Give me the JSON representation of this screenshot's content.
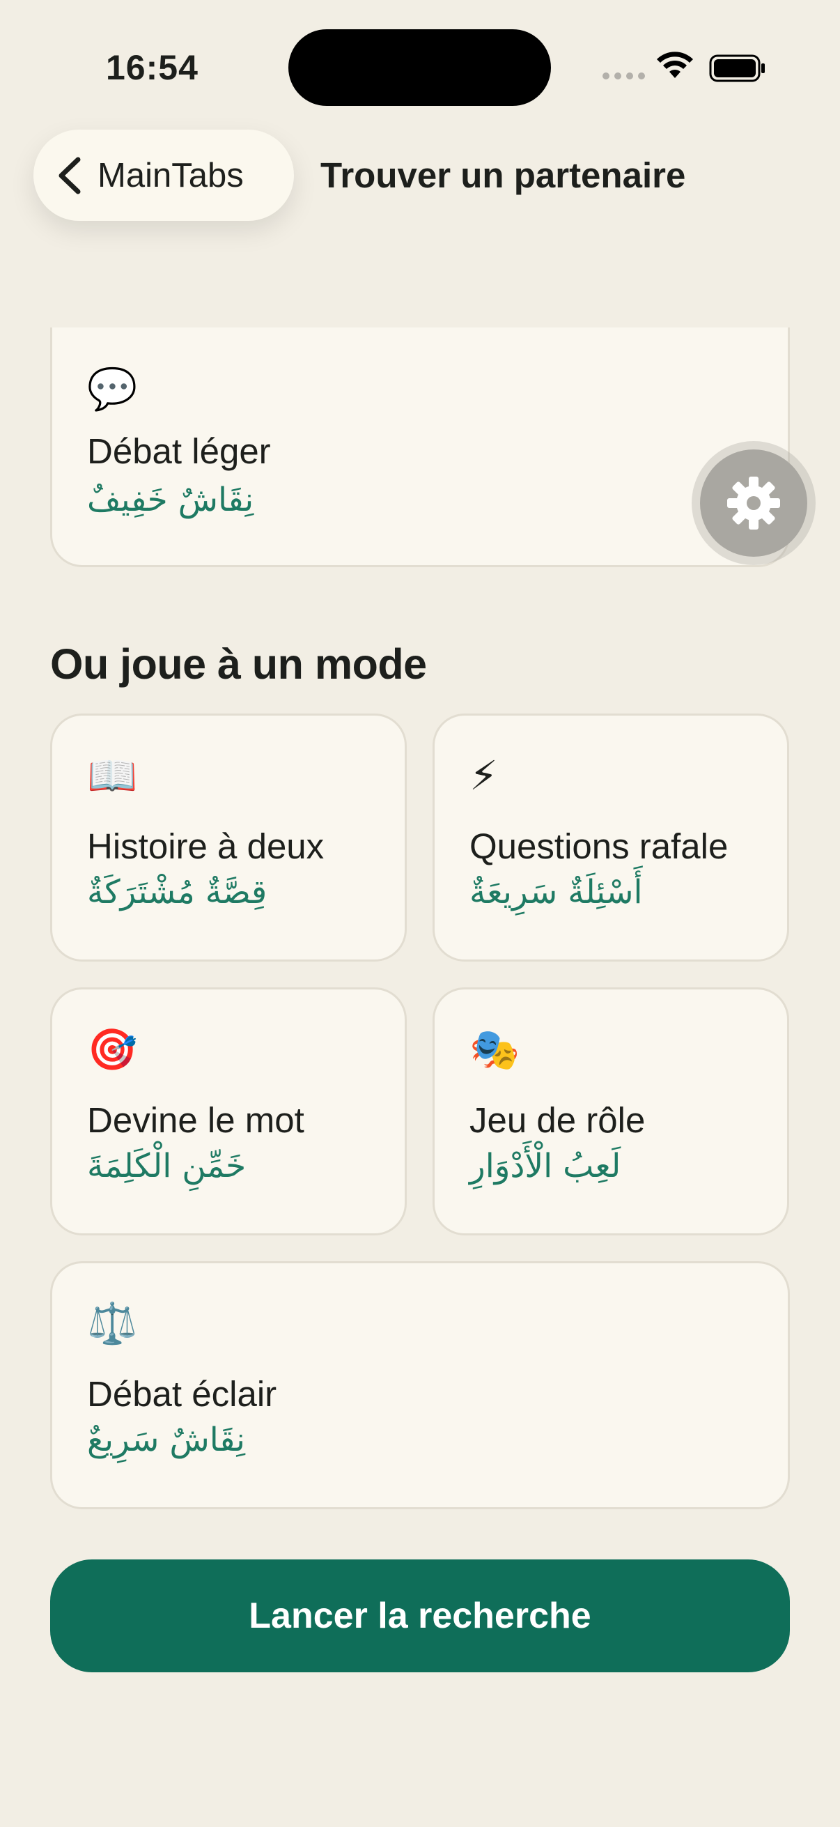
{
  "status_bar": {
    "time": "16:54"
  },
  "nav": {
    "back_label": "MainTabs",
    "title": "Trouver un partenaire"
  },
  "topic_card": {
    "icon": "💬",
    "title": "Débat léger",
    "arabic": "نِقَاشٌ خَفِيفٌ"
  },
  "section_title": "Ou joue à un mode",
  "modes": [
    {
      "icon": "📖",
      "title": "Histoire à deux",
      "arabic": "قِصَّةٌ مُشْتَرَكَةٌ"
    },
    {
      "icon": "⚡",
      "title": "Questions rafale",
      "arabic": "أَسْئِلَةٌ سَرِيعَةٌ"
    },
    {
      "icon": "🎯",
      "title": "Devine le mot",
      "arabic": "خَمِّنِ الْكَلِمَةَ"
    },
    {
      "icon": "🎭",
      "title": "Jeu de rôle",
      "arabic": "لَعِبُ الْأَدْوَارِ"
    },
    {
      "icon": "⚖️",
      "title": "Débat éclair",
      "arabic": "نِقَاشٌ سَرِيعٌ"
    }
  ],
  "cta_label": "Lancer la recherche",
  "icons": {
    "back": "chevron-left-icon",
    "settings": "gear-icon",
    "wifi": "wifi-icon",
    "battery": "battery-icon"
  },
  "colors": {
    "accent": "#0f6e59",
    "arabic_text": "#1e7a63",
    "background": "#f2eee4"
  }
}
